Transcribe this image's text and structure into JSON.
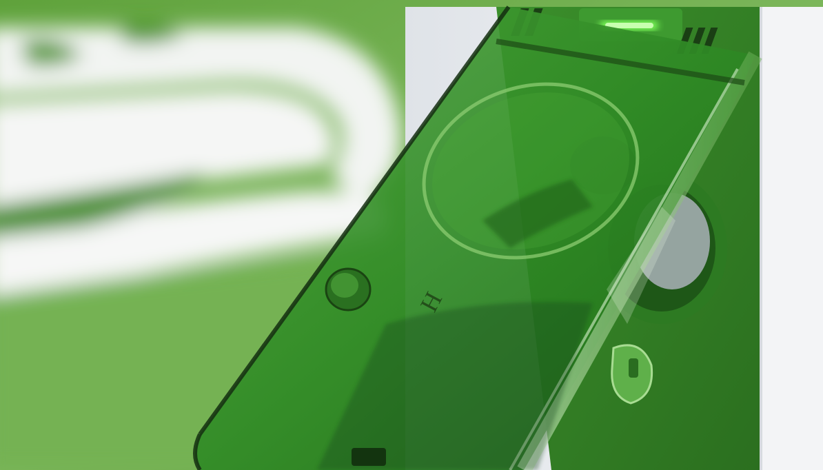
{
  "photo": {
    "subject": "green-translucent-socket-cover",
    "cover_marking": "H",
    "colors": {
      "background_green": "#6fa84e",
      "deep_green": "#2f7d22",
      "cover_green": "#3f9a2f",
      "cover_dark": "#1a4a14",
      "light_green": "#9fd07f",
      "wall_white": "#eef0f3",
      "led_green": "#7dff5a"
    }
  }
}
